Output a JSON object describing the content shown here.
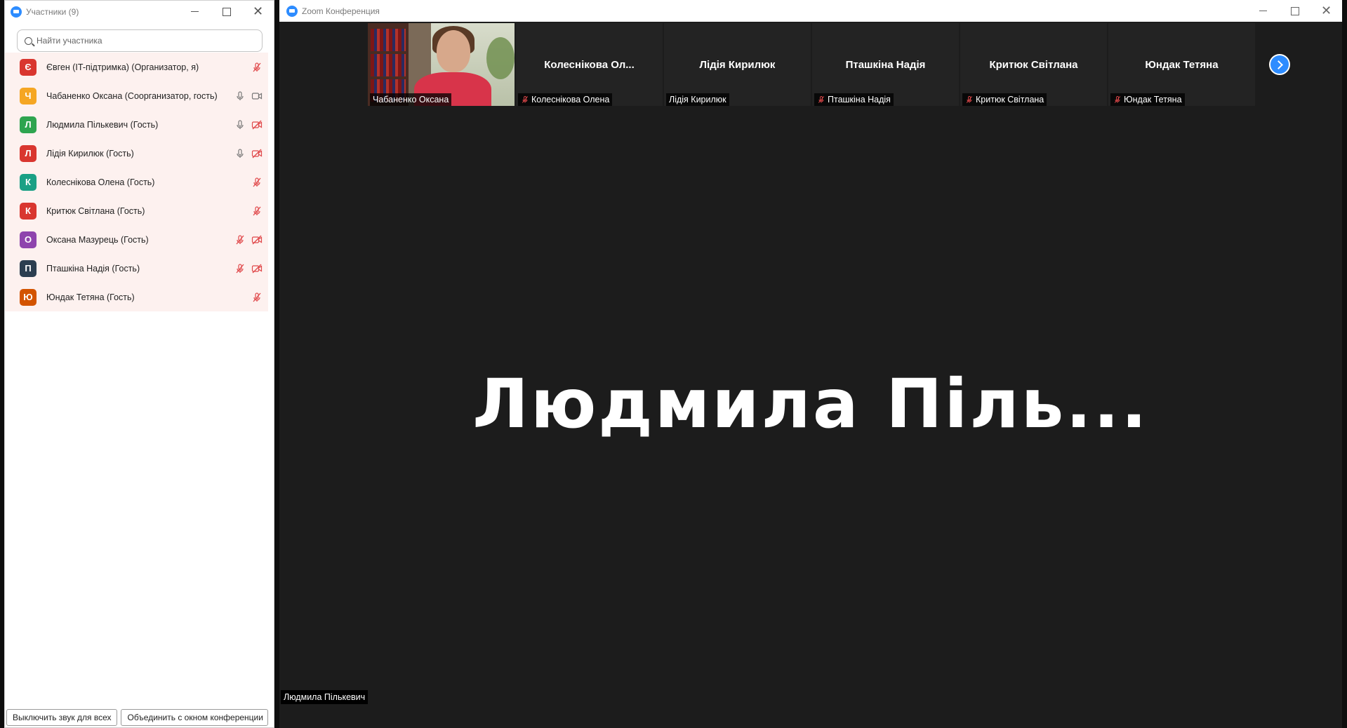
{
  "participants_window": {
    "title": "Участники (9)",
    "search_placeholder": "Найти участника",
    "participants": [
      {
        "initial": "Є",
        "name": "Євген (IT-підтримка) (Организатор, я)",
        "color": "#d9362f",
        "mic": "muted",
        "video": "none"
      },
      {
        "initial": "Ч",
        "name": "Чабаненко Оксана (Соорганизатор, гость)",
        "color": "#f5a623",
        "mic": "on",
        "video": "on"
      },
      {
        "initial": "Л",
        "name": "Людмила Пількевич (Гость)",
        "color": "#2ea44f",
        "mic": "on",
        "video": "off"
      },
      {
        "initial": "Л",
        "name": "Лідія Кирилюк (Гость)",
        "color": "#d9362f",
        "mic": "on",
        "video": "off"
      },
      {
        "initial": "К",
        "name": "Колеснікова Олена (Гость)",
        "color": "#1aa085",
        "mic": "muted",
        "video": "none"
      },
      {
        "initial": "К",
        "name": "Критюк Світлана (Гость)",
        "color": "#d9362f",
        "mic": "muted",
        "video": "none"
      },
      {
        "initial": "О",
        "name": "Оксана Мазурець (Гость)",
        "color": "#8e44ad",
        "mic": "muted",
        "video": "off"
      },
      {
        "initial": "П",
        "name": "Пташкіна Надія (Гость)",
        "color": "#2c3e50",
        "mic": "muted",
        "video": "off"
      },
      {
        "initial": "Ю",
        "name": "Юндак Тетяна (Гость)",
        "color": "#d35400",
        "mic": "muted",
        "video": "none"
      }
    ],
    "footer": {
      "mute_all_label": "Выключить звук для всех",
      "merge_label": "Объединить с окном конференции"
    }
  },
  "meeting_window": {
    "title": "Zoom Конференция",
    "tiles": [
      {
        "name": "Чабаненко Оксана",
        "label": "Чабаненко Оксана",
        "muted": false,
        "video": true
      },
      {
        "name": "Колеснікова Ол...",
        "label": "Колеснікова Олена",
        "muted": true,
        "video": false
      },
      {
        "name": "Лідія Кирилюк",
        "label": "Лідія Кирилюк",
        "muted": false,
        "video": false
      },
      {
        "name": "Пташкіна Надія",
        "label": "Пташкіна Надія",
        "muted": true,
        "video": false
      },
      {
        "name": "Критюк Світлана",
        "label": "Критюк Світлана",
        "muted": true,
        "video": false
      },
      {
        "name": "Юндак Тетяна",
        "label": "Юндак Тетяна",
        "muted": true,
        "video": false
      }
    ],
    "active_speaker": {
      "display_name": "Людмила  Піль...",
      "label": "Людмила Пількевич"
    }
  },
  "colors": {
    "accent": "#2d8cff",
    "muted_red": "#e0484a",
    "row_highlight": "#fdf1ef",
    "meeting_bg": "#1c1c1c"
  }
}
